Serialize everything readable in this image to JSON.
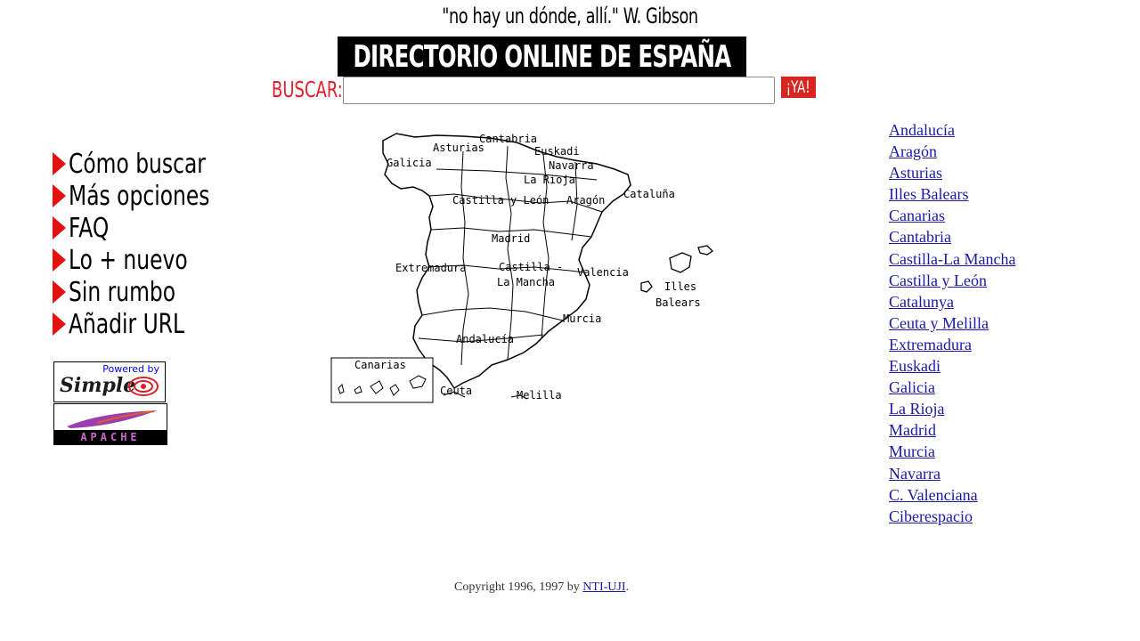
{
  "header": {
    "quote": "\"no hay un dónde, allí.\" W. Gibson",
    "title": "DIRECTORIO ONLINE DE ESPAÑA"
  },
  "search": {
    "label": "BUSCAR:",
    "value": "",
    "button_label": "¡YA!"
  },
  "nav": {
    "items": [
      {
        "label": "Cómo buscar"
      },
      {
        "label": "Más opciones"
      },
      {
        "label": "FAQ"
      },
      {
        "label": "Lo + nuevo"
      },
      {
        "label": "Sin rumbo"
      },
      {
        "label": "Añadir URL"
      }
    ]
  },
  "logos": {
    "simple_small": "Powered by",
    "simple_big": "Simple",
    "apache": "APACHE"
  },
  "map": {
    "labels": {
      "cantabria": "Cantabria",
      "asturias": "Asturias",
      "euskadi": "Euskadi",
      "galicia": "Galicia",
      "navarra": "Navarra",
      "la_rioja": "La Rioja",
      "castilla_leon": "Castilla y León",
      "aragon": "Aragón",
      "catalunya": "Cataluña",
      "madrid": "Madrid",
      "extremadura": "Extremadura",
      "castilla_mancha_1": "Castilla -",
      "castilla_mancha_2": "La Mancha",
      "valencia": "Valencia",
      "baleares_1": "Illes",
      "baleares_2": "Balears",
      "murcia": "Murcia",
      "andalucia": "Andalucía",
      "canarias": "Canarias",
      "ceuta": "Ceuta",
      "melilla": "Melilla"
    }
  },
  "regions": [
    "Andalucía",
    "Aragón",
    "Asturias",
    "Illes Balears",
    "Canarias",
    "Cantabria",
    "Castilla-La Mancha",
    "Castilla y León",
    "Catalunya",
    "Ceuta y Melilla",
    "Extremadura",
    "Euskadi",
    "Galicia",
    "La Rioja",
    "Madrid",
    "Murcia",
    "Navarra",
    "C. Valenciana",
    "Ciberespacio"
  ],
  "footer": {
    "text": "Copyright 1996, 1997 by ",
    "link": "NTI-UJI",
    "end": "."
  },
  "colors": {
    "accent_red": "#e4202a",
    "link_blue": "#1a1aa6",
    "banner_bg": "#000000"
  }
}
